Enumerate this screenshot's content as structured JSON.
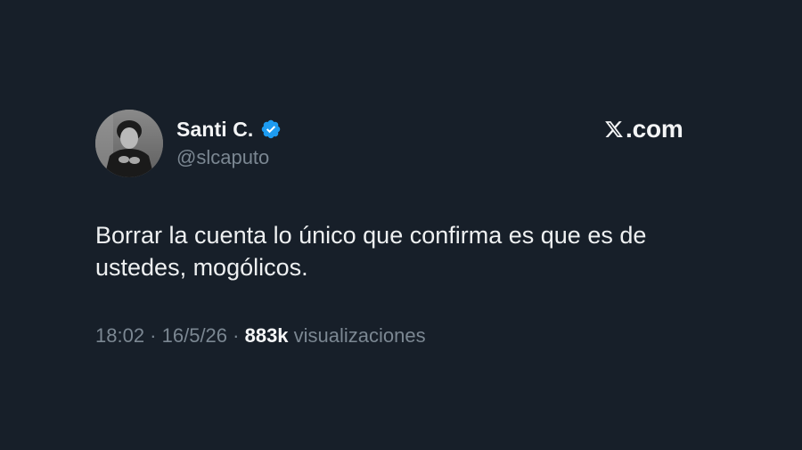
{
  "author": {
    "display_name": "Santi C.",
    "handle": "@slcaputo",
    "verified": true,
    "verified_color": "#1d9bf0",
    "avatar_icon": "profile-photo"
  },
  "brand": {
    "icon": "x-logo-icon",
    "text": ".com"
  },
  "tweet": {
    "text": "Borrar la cuenta lo único que confirma es que es de\nustedes, mogólicos."
  },
  "meta": {
    "time": "18:02",
    "separator_1": " · ",
    "date": "16/5/26",
    "separator_2": " · ",
    "views_count": "883k",
    "views_label": " visualizaciones"
  },
  "colors": {
    "background": "#171f29",
    "primary_text": "#eef0f1",
    "secondary_text": "#7b8792"
  }
}
